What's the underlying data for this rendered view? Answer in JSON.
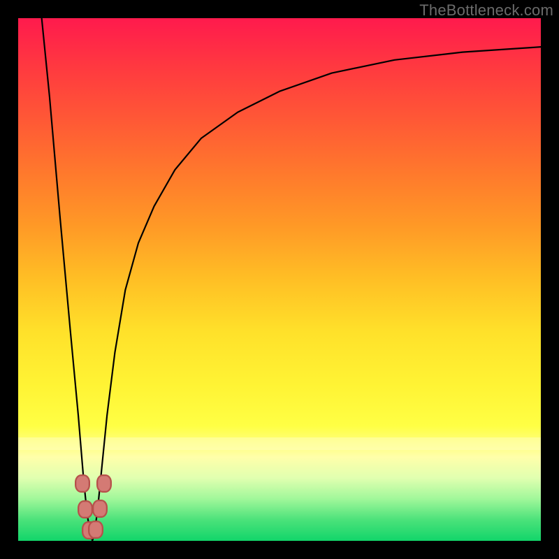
{
  "watermark": "TheBottleneck.com",
  "chart_data": {
    "type": "line",
    "title": "",
    "xlabel": "",
    "ylabel": "",
    "xlim": [
      0,
      100
    ],
    "ylim": [
      0,
      100
    ],
    "grid": false,
    "legend": false,
    "background_gradient": {
      "stops": [
        {
          "pos": 0,
          "color": "#ff1a4d"
        },
        {
          "pos": 50,
          "color": "#ffbf25"
        },
        {
          "pos": 78,
          "color": "#ffff44"
        },
        {
          "pos": 100,
          "color": "#12d56a"
        }
      ]
    },
    "series": [
      {
        "name": "curve",
        "x": [
          4.5,
          6,
          8,
          10,
          11.5,
          12.5,
          13.2,
          13.8,
          14.2,
          14.6,
          15.2,
          16,
          17,
          18.5,
          20.5,
          23,
          26,
          30,
          35,
          42,
          50,
          60,
          72,
          85,
          100
        ],
        "y": [
          100,
          85,
          62,
          40,
          24,
          12,
          5,
          1.5,
          0,
          1.5,
          6,
          14,
          24,
          36,
          48,
          57,
          64,
          71,
          77,
          82,
          86,
          89.5,
          92,
          93.5,
          94.5
        ]
      }
    ],
    "markers": [
      {
        "x": 12.3,
        "y": 11
      },
      {
        "x": 12.9,
        "y": 6
      },
      {
        "x": 13.6,
        "y": 2
      },
      {
        "x": 14.9,
        "y": 2.2
      },
      {
        "x": 15.6,
        "y": 6.2
      },
      {
        "x": 16.4,
        "y": 11
      }
    ],
    "annotations": []
  },
  "colors": {
    "curve": "#000000",
    "marker_fill": "#d47a74",
    "marker_stroke": "#b84f49",
    "frame": "#000000"
  }
}
